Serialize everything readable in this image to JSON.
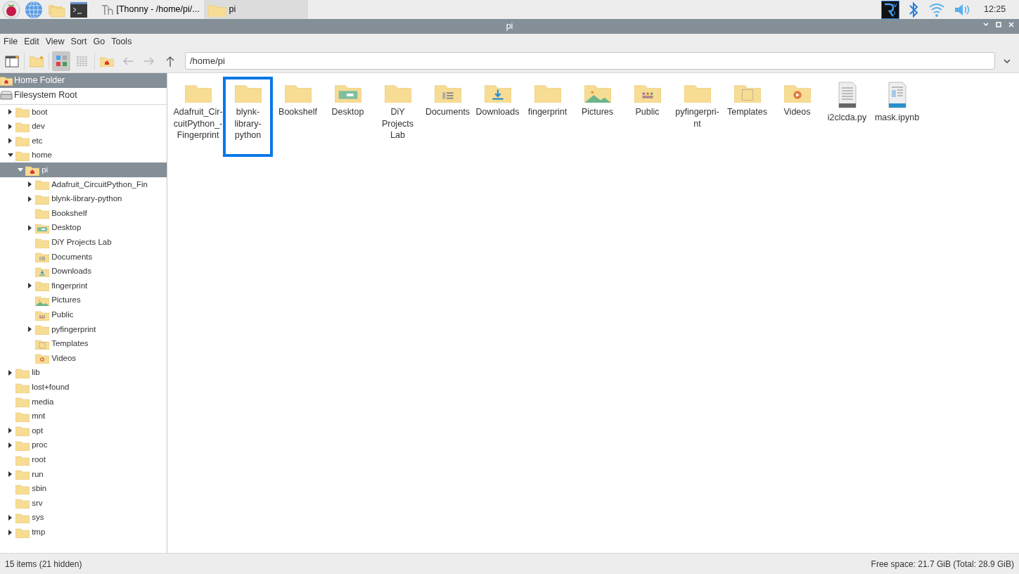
{
  "taskbar": {
    "windows": [
      {
        "title": "[Thonny  -  /home/pi/...",
        "kind": "thonny",
        "selected": false
      },
      {
        "title": "pi",
        "kind": "folder",
        "selected": true
      }
    ],
    "clock": "12:25"
  },
  "window": {
    "title": "pi"
  },
  "menu": [
    "File",
    "Edit",
    "View",
    "Sort",
    "Go",
    "Tools"
  ],
  "toolbar": {
    "icon_view": true,
    "list_view": false,
    "path": "/home/pi"
  },
  "places": [
    {
      "label": "Home Folder",
      "kind": "home",
      "selected": true
    },
    {
      "label": "Filesystem Root",
      "kind": "drive",
      "selected": false
    }
  ],
  "tree": [
    {
      "label": "boot",
      "kind": "folder",
      "has_children": true,
      "expanded": false,
      "selected": false
    },
    {
      "label": "dev",
      "kind": "folder",
      "has_children": true,
      "expanded": false,
      "selected": false
    },
    {
      "label": "etc",
      "kind": "folder",
      "has_children": true,
      "expanded": false,
      "selected": false
    },
    {
      "label": "home",
      "kind": "folder",
      "has_children": true,
      "expanded": true,
      "selected": false,
      "children": [
        {
          "label": "pi",
          "kind": "home",
          "has_children": true,
          "expanded": true,
          "selected": true,
          "children": [
            {
              "label": "Adafruit_CircuitPython_Fin",
              "kind": "folder",
              "has_children": true,
              "expanded": false,
              "selected": false
            },
            {
              "label": "blynk-library-python",
              "kind": "folder",
              "has_children": true,
              "expanded": false,
              "selected": false
            },
            {
              "label": "Bookshelf",
              "kind": "folder",
              "has_children": false,
              "expanded": false,
              "selected": false
            },
            {
              "label": "Desktop",
              "kind": "desktop",
              "has_children": true,
              "expanded": false,
              "selected": false
            },
            {
              "label": "DiY Projects Lab",
              "kind": "folder",
              "has_children": false,
              "expanded": false,
              "selected": false
            },
            {
              "label": "Documents",
              "kind": "documents",
              "has_children": false,
              "expanded": false,
              "selected": false
            },
            {
              "label": "Downloads",
              "kind": "downloads",
              "has_children": false,
              "expanded": false,
              "selected": false
            },
            {
              "label": "fingerprint",
              "kind": "folder",
              "has_children": true,
              "expanded": false,
              "selected": false
            },
            {
              "label": "Pictures",
              "kind": "pictures",
              "has_children": false,
              "expanded": false,
              "selected": false
            },
            {
              "label": "Public",
              "kind": "public",
              "has_children": false,
              "expanded": false,
              "selected": false
            },
            {
              "label": "pyfingerprint",
              "kind": "folder",
              "has_children": true,
              "expanded": false,
              "selected": false
            },
            {
              "label": "Templates",
              "kind": "templates",
              "has_children": false,
              "expanded": false,
              "selected": false
            },
            {
              "label": "Videos",
              "kind": "videos",
              "has_children": false,
              "expanded": false,
              "selected": false
            }
          ]
        }
      ]
    },
    {
      "label": "lib",
      "kind": "folder",
      "has_children": true,
      "expanded": false,
      "selected": false
    },
    {
      "label": "lost+found",
      "kind": "folder",
      "has_children": false,
      "expanded": false,
      "selected": false
    },
    {
      "label": "media",
      "kind": "folder",
      "has_children": false,
      "expanded": false,
      "selected": false
    },
    {
      "label": "mnt",
      "kind": "folder",
      "has_children": false,
      "expanded": false,
      "selected": false
    },
    {
      "label": "opt",
      "kind": "folder",
      "has_children": true,
      "expanded": false,
      "selected": false
    },
    {
      "label": "proc",
      "kind": "folder",
      "has_children": true,
      "expanded": false,
      "selected": false
    },
    {
      "label": "root",
      "kind": "folder",
      "has_children": false,
      "expanded": false,
      "selected": false
    },
    {
      "label": "run",
      "kind": "folder",
      "has_children": true,
      "expanded": false,
      "selected": false
    },
    {
      "label": "sbin",
      "kind": "folder",
      "has_children": false,
      "expanded": false,
      "selected": false
    },
    {
      "label": "srv",
      "kind": "folder",
      "has_children": false,
      "expanded": false,
      "selected": false
    },
    {
      "label": "sys",
      "kind": "folder",
      "has_children": true,
      "expanded": false,
      "selected": false
    },
    {
      "label": "tmp",
      "kind": "folder",
      "has_children": true,
      "expanded": false,
      "selected": false
    }
  ],
  "files": [
    {
      "label": "Adafruit_Cir-\ncuitPython_-\nFingerprint",
      "kind": "folder",
      "selected": false
    },
    {
      "label": "blynk-\nlibrary-\npython",
      "kind": "folder",
      "selected": true
    },
    {
      "label": "Bookshelf",
      "kind": "folder",
      "selected": false
    },
    {
      "label": "Desktop",
      "kind": "desktop",
      "selected": false
    },
    {
      "label": "DiY\nProjects Lab",
      "kind": "folder",
      "selected": false
    },
    {
      "label": "Documents",
      "kind": "documents",
      "selected": false
    },
    {
      "label": "Downloads",
      "kind": "downloads",
      "selected": false
    },
    {
      "label": "fingerprint",
      "kind": "folder",
      "selected": false
    },
    {
      "label": "Pictures",
      "kind": "pictures",
      "selected": false
    },
    {
      "label": "Public",
      "kind": "public",
      "selected": false
    },
    {
      "label": "pyfingerpri-\nnt",
      "kind": "folder",
      "selected": false
    },
    {
      "label": "Templates",
      "kind": "templates",
      "selected": false
    },
    {
      "label": "Videos",
      "kind": "videos",
      "selected": false
    },
    {
      "label": "i2clcda.py",
      "kind": "text-file",
      "selected": false
    },
    {
      "label": "mask.ipynb",
      "kind": "doc-file",
      "selected": false
    }
  ],
  "status_bar": {
    "left": "15 items (21 hidden)",
    "right": "Free space: 21.7 GiB (Total: 28.9 GiB)"
  }
}
